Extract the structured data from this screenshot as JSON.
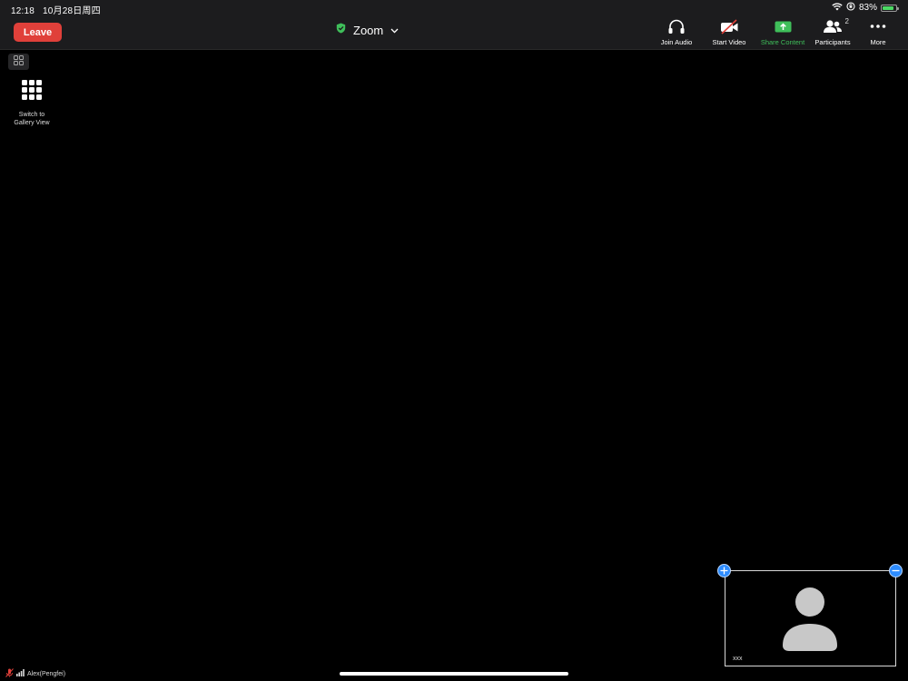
{
  "status_bar": {
    "time": "12:18",
    "date": "10月28日周四",
    "battery_text": "83%",
    "battery_level": 0.83
  },
  "meeting": {
    "leave_label": "Leave",
    "title": "Zoom",
    "security_color": "#3fbf5a"
  },
  "toolbar": {
    "join_audio": "Join Audio",
    "start_video": "Start Video",
    "share_content": "Share Content",
    "participants": "Participants",
    "participants_count": "2",
    "more": "More"
  },
  "gallery": {
    "switch_label_line1": "Switch to",
    "switch_label_line2": "Gallery View"
  },
  "self_view": {
    "name": "xxx"
  },
  "bottom_status": {
    "user_name": "Alex(Pengfei)"
  },
  "colors": {
    "leave": "#e0403a",
    "accent_blue": "#2d8cff",
    "share_green": "#3fbf5a",
    "muted_red": "#e0403a"
  },
  "icons": {
    "security": "shield-check-icon",
    "chevron": "chevron-down-icon",
    "audio": "headphones-icon",
    "video": "video-off-icon",
    "share": "share-up-arrow-icon",
    "participants": "people-icon",
    "more": "ellipsis-icon",
    "grid_toggle": "grid-icon",
    "gallery": "keypad-grid-icon",
    "avatar": "person-icon",
    "mic_muted": "mic-muted-icon",
    "signal": "signal-bars-icon"
  }
}
